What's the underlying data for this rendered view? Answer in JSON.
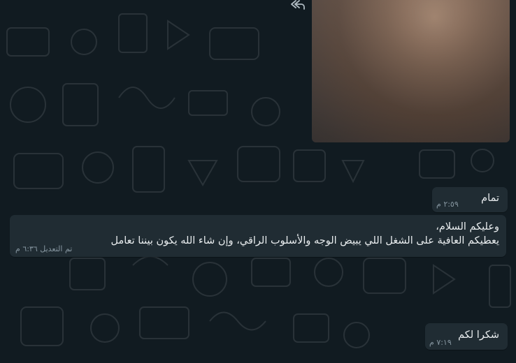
{
  "colors": {
    "chat_background": "#111b21",
    "bubble_incoming": "#202c33",
    "text_primary": "#e9edef",
    "text_meta": "#8696a0"
  },
  "icons": {
    "forward": "reply-arrow-icon"
  },
  "messages": [
    {
      "text": "تمام",
      "time": "٢:٥٩ م"
    },
    {
      "line1": "وعليكم السلام،",
      "line2": "يعطيكم العافية على الشغل اللي يبيض الوجه والأسلوب الراقي، وإن شاء الله يكون بيننا تعامل",
      "edited_label": "تم التعديل",
      "time": "٦:٣٦ م"
    },
    {
      "text": "شكرا لكم",
      "time": "٧:١٩ م"
    }
  ]
}
